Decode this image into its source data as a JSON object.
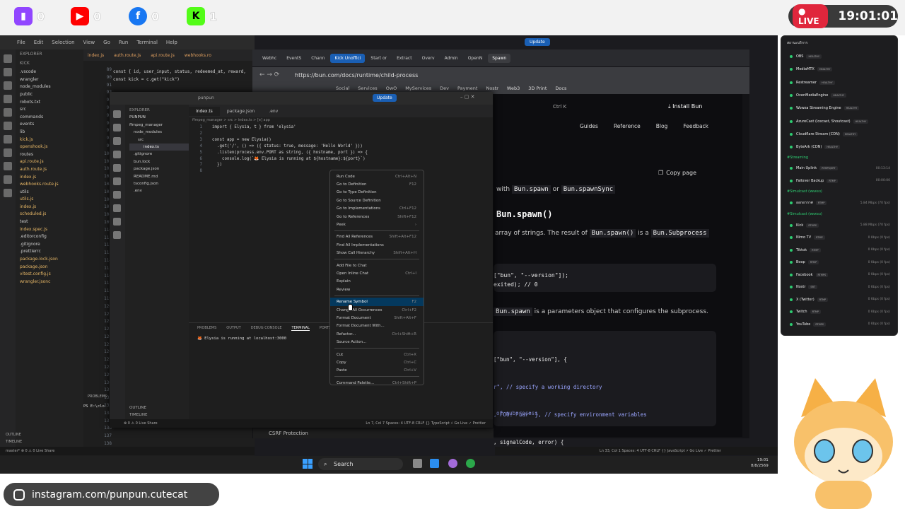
{
  "stream": {
    "socials": [
      {
        "name": "twitch-icon",
        "count": "0",
        "color": "#9146ff"
      },
      {
        "name": "youtube-icon",
        "count": "0",
        "color": "#ff0000"
      },
      {
        "name": "facebook-icon",
        "count": "0",
        "color": "#1877f2"
      },
      {
        "name": "kick-icon",
        "count": "1",
        "color": "#53fc18"
      }
    ],
    "live_label": "LIVE",
    "clock": "19:01:01",
    "footer": "instagram.com/punpun.cutecat"
  },
  "vscode_back": {
    "menu": [
      "File",
      "Edit",
      "Selection",
      "View",
      "Go",
      "Run",
      "Terminal",
      "Help"
    ],
    "explorer_label": "EXPLORER",
    "root": "KICK",
    "files": [
      ".vscode",
      "wrangler",
      "node_modules",
      "public",
      "robots.txt",
      "src",
      "commands",
      "events",
      "lib",
      "kick.js",
      "openshook.js",
      "routes",
      "api.route.js",
      "auth.route.js",
      "index.js",
      "webhooks.route.js",
      "utils",
      "utils.js",
      "index.js",
      "scheduled.js",
      "test",
      "index.spec.js",
      ".editorconfig",
      ".gitignore",
      ".prettierrc",
      "package-lock.json",
      "package.json",
      "vitest.config.js",
      "wrangler.jsonc"
    ],
    "tabs": [
      "index.js",
      "auth.route.js",
      "api.route.js",
      "webhooks.ro"
    ],
    "lines": [
      "89",
      "90",
      "91",
      "92",
      "93",
      "94",
      "95",
      "96",
      "97",
      "98",
      "99",
      "100",
      "101",
      "102",
      "103",
      "104",
      "105",
      "106",
      "107",
      "108",
      "109",
      "110",
      "111",
      "112",
      "113",
      "114",
      "115",
      "116",
      "117",
      "118",
      "119",
      "120",
      "121",
      "122",
      "123",
      "124",
      "125",
      "126",
      "127",
      "128",
      "129",
      "130",
      "131",
      "132",
      "133",
      "134",
      "135",
      "136",
      "137",
      "138"
    ],
    "code": [
      "const { id, user_input, status, redeemed_at, reward,",
      "const kick = c.get(\"kick\")"
    ],
    "outline": "OUTLINE",
    "timeline": "TIMELINE",
    "problems": "PROBLEMS",
    "ps": "PS E:\\clo",
    "status": "master*  ⊗ 0 ⚠ 0   Live Share"
  },
  "browser": {
    "tabs": [
      "Webhc",
      "EventS",
      "Chann",
      "Kick Unoffici",
      "Start or",
      "Extract",
      "Overv",
      "Admin",
      "OpenN",
      "Spawn"
    ],
    "update": "Update",
    "url": "https://bun.com/docs/runtime/child-process",
    "bookmarks": [
      "Social",
      "Services",
      "OwO",
      "MyServices",
      "Dev",
      "Payment",
      "Nostr",
      "Web3",
      "3D Print",
      "Docs"
    ],
    "ctrl_k": "Ctrl K",
    "install": "Install Bun",
    "nav": [
      "Guides",
      "Reference",
      "Blog",
      "Feedback"
    ],
    "copy_page": "Copy page",
    "p1a": "with",
    "p1b": "Bun.spawn",
    "p1c": "or",
    "p1d": "Bun.spawnSync",
    "h2": "Bun.spawn()",
    "p2a": "array of strings. The result of",
    "p2b": "Bun.spawn()",
    "p2c": "is a",
    "p2d": "Bun.Subprocess",
    "code1a": "[\"bun\", \"--version\"]);",
    "code1b": "exited); // 0",
    "p3a": "Bun.spawn",
    "p3b": "is a parameters object that configures the subprocess.",
    "code2": [
      "[\"bun\", \"--version\"], {",
      "r\", // specify a working directory",
      ", FOO: \"bar\" }, // specify environment variables",
      ", signalCode, error) {"
    ],
    "code3": "of subprocess",
    "csrf": "CSRF Protection",
    "status": "Ln 33, Col 1  Spaces: 4  UTF-8  CRLF  {} JavaScript  ⚡ Go Live  ✓ Prettier"
  },
  "vscode_front": {
    "title": "punpun",
    "update": "Update",
    "explorer_label": "EXPLORER",
    "root": "PUNPUN",
    "files": [
      "ffmpeg_manager",
      "node_modules",
      "src",
      "index.ts",
      ".gitignore",
      "bun.lock",
      "package.json",
      "README.md",
      "tsconfig.json",
      ".env"
    ],
    "tabs": [
      "index.ts",
      "package.json",
      ".env"
    ],
    "breadcrumb": "ffmpeg_manager > src > index.ts > [e] app",
    "code": [
      "import { Elysia, t } from 'elysia'",
      "",
      "const app = new Elysia()",
      "  .get('/', () => ({ status: true, message: 'Hello World' }))",
      "  .listen(process.env.PORT as string, ({ hostname, port }) => {",
      "    console.log(`🦊 Elysia is running at ${hostname}:${port}`)",
      "  })",
      ""
    ],
    "line_numbers": [
      "1",
      "2",
      "3",
      "4",
      "5",
      "6",
      "7",
      "8"
    ],
    "panel_tabs": [
      "PROBLEMS",
      "OUTPUT",
      "DEBUG CONSOLE",
      "TERMINAL",
      "PORTS"
    ],
    "terminal": "🦊 Elysia is running at localhost:3000",
    "outline": "OUTLINE",
    "timeline": "TIMELINE",
    "status": "⊗ 0 ⚠ 0   Live Share",
    "status_right": "Ln 7, Col 7  Spaces: 4  UTF-8  CRLF  {} TypeScript  ⚡ Go Live  ✓ Prettier"
  },
  "context_menu": [
    {
      "label": "Run Code",
      "key": "Ctrl+Alt+N"
    },
    {
      "label": "Go to Definition",
      "key": "F12"
    },
    {
      "label": "Go to Type Definition",
      "key": ""
    },
    {
      "label": "Go to Source Definition",
      "key": ""
    },
    {
      "label": "Go to Implementations",
      "key": "Ctrl+F12"
    },
    {
      "label": "Go to References",
      "key": "Shift+F12"
    },
    {
      "label": "Peek",
      "key": "›"
    },
    {
      "sep": true
    },
    {
      "label": "Find All References",
      "key": "Shift+Alt+F12"
    },
    {
      "label": "Find All Implementations",
      "key": ""
    },
    {
      "label": "Show Call Hierarchy",
      "key": "Shift+Alt+H"
    },
    {
      "sep": true
    },
    {
      "label": "Add File to Chat",
      "key": ""
    },
    {
      "label": "Open Inline Chat",
      "key": "Ctrl+I"
    },
    {
      "label": "Explain",
      "key": ""
    },
    {
      "label": "Review",
      "key": ""
    },
    {
      "sep": true
    },
    {
      "label": "Rename Symbol",
      "key": "F2",
      "selected": true
    },
    {
      "label": "Change All Occurrences",
      "key": "Ctrl+F2"
    },
    {
      "label": "Format Document",
      "key": "Shift+Alt+F"
    },
    {
      "label": "Format Document With...",
      "key": ""
    },
    {
      "label": "Refactor...",
      "key": "Ctrl+Shift+R"
    },
    {
      "label": "Source Action...",
      "key": ""
    },
    {
      "sep": true
    },
    {
      "label": "Cut",
      "key": "Ctrl+X"
    },
    {
      "label": "Copy",
      "key": "Ctrl+C"
    },
    {
      "label": "Paste",
      "key": "Ctrl+V"
    },
    {
      "sep": true
    },
    {
      "label": "Command Palette...",
      "key": "Ctrl+Shift+P"
    }
  ],
  "taskbar": {
    "search": "Search",
    "time": "19:01",
    "date": "8/8/2569"
  },
  "status_panel": {
    "title": "สถานะบริการ",
    "services": [
      {
        "name": "OBS",
        "badge": "HEALTHY"
      },
      {
        "name": "MediaMTX",
        "badge": "HEALTHY"
      },
      {
        "name": "Restreamer",
        "badge": "HEALTHY"
      },
      {
        "name": "OvenMediaEngine",
        "badge": "HEALTHY"
      },
      {
        "name": "Wowza Streaming Engine",
        "badge": "HEALTHY"
      },
      {
        "name": "AzureCast (Icecast, Shoutcast)",
        "badge": "HEALTHY"
      },
      {
        "name": "Cloudflare Stream (CDN)",
        "badge": "HEALTHY"
      },
      {
        "name": "ByteArk (CDN)",
        "badge": "HEALTHY"
      }
    ],
    "streaming_label": "#Streaming",
    "streaming": [
      {
        "name": "Main Uplink",
        "badge": "RTMPS/SRT",
        "r": "00:13:14"
      },
      {
        "name": "Failover Backup",
        "badge": "RTMP",
        "r": "00:00:00"
      }
    ],
    "simulcast_label1": "#Simulcast (ทดสอบ)",
    "simulcast1": [
      {
        "name": "ออกอากาศ",
        "badge": "RTMP",
        "r": "5.84 Mbps   (70 fps)"
      }
    ],
    "simulcast_label2": "#Simulcast (ทดสอบ)",
    "simulcast2": [
      {
        "name": "Kick",
        "badge": "RTMPS",
        "r": "5.88 Mbps   (70 fps)"
      },
      {
        "name": "Nimo TV",
        "badge": "RTMP",
        "r": "0 Kbps   (0 fps)"
      },
      {
        "name": "Tiktok",
        "badge": "RTMP",
        "r": "0 Kbps   (0 fps)"
      },
      {
        "name": "Boop",
        "badge": "RTMP",
        "r": "0 Kbps   (0 fps)"
      },
      {
        "name": "Facebook",
        "badge": "RTMPS",
        "r": "0 Kbps   (0 fps)"
      },
      {
        "name": "Nostr",
        "badge": "SRT",
        "r": "0 Kbps   (0 fps)"
      },
      {
        "name": "X (Twitter)",
        "badge": "RTMP",
        "r": "0 Kbps   (0 fps)"
      },
      {
        "name": "Twitch",
        "badge": "RTMP",
        "r": "0 Kbps   (0 fps)"
      },
      {
        "name": "YouTube",
        "badge": "RTMPS",
        "r": "0 Kbps   (0 fps)"
      }
    ]
  }
}
